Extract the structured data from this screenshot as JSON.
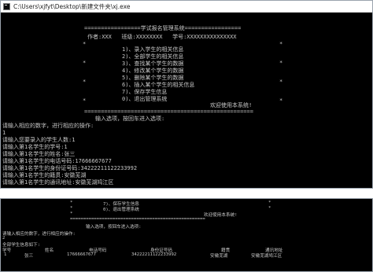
{
  "window": {
    "title": "C:\\Users\\xjfyt\\Desktop\\新建文件夹\\xj.exe"
  },
  "menu": {
    "top_rule": "=================学试报名管理系统=================",
    "author_line": "作者:XXX   班级:XXXXXXXX   学号:XXXXXXXXXXXXXXX",
    "items": [
      "1)、录入学生的相关信息",
      "2)、全部学生的相关信息",
      "3)、查找某个学生的数据",
      "4)、修改某个学生的数据",
      "5)、删除某个学生的数据",
      "6)、插入某个学生的相关信息",
      "7)、保存学生信息",
      "0)、退出管理系统"
    ],
    "welcome": "欢迎使用本系统!",
    "bottom_rule": "===================================================",
    "side_mark": "*"
  },
  "console": {
    "prompt_line": "输入选项，按回车进入选项:",
    "lines": [
      "请输入相应的数字，进行相应的操作:",
      "1",
      "请输入您要录入的学生人数:1",
      "请输入第1名学生的学号:1",
      "请输入第1名学生的姓名:张三",
      "请输入第1名学生的电话号码:17666667677",
      "请输入第1名学生的身份证号码:34222211122233992",
      "请输入第1名学生的籍贯:安徽芜湖",
      "请输入第1名学生的通讯地址:安徽芜湖鸠江区"
    ]
  },
  "second_capture": {
    "menu_tail": [
      "7)、保存学生信息",
      "0)、退出管理系统"
    ],
    "welcome": "欢迎使用本系统!",
    "bottom_rule": "===================================================",
    "prompt_line": "输入选项，按回车进入选项:",
    "instruction": "请输入相应的数字，进行相应的操作:",
    "choice": "2",
    "heading": "全部学生信息如下:",
    "table": {
      "headers": [
        "学号",
        "姓名",
        "电话号码",
        "身份证号码",
        "籍贯",
        "通讯地址"
      ],
      "rows": [
        [
          "1",
          "张三",
          "17666667677",
          "34222211122233992",
          "安徽芜湖",
          "安徽芜湖鸠江区"
        ]
      ]
    }
  }
}
